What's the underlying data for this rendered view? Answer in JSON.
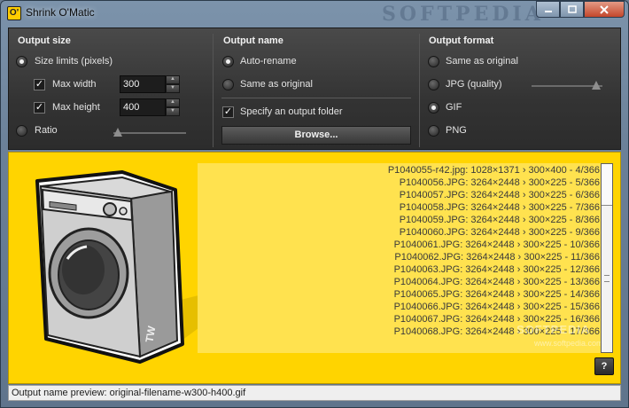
{
  "window": {
    "title": "Shrink O'Matic",
    "app_icon_glyph": "O'",
    "watermark": "SOFTPEDIA",
    "controls": [
      "minimize-icon",
      "maximize-icon",
      "close-icon"
    ]
  },
  "output_size": {
    "title": "Output size",
    "size_limits_label": "Size limits (pixels)",
    "size_limits_selected": true,
    "max_width_label": "Max width",
    "max_width_checked": true,
    "max_width_value": "300",
    "max_height_label": "Max height",
    "max_height_checked": true,
    "max_height_value": "400",
    "ratio_label": "Ratio",
    "ratio_selected": false
  },
  "output_name": {
    "title": "Output name",
    "auto_rename_label": "Auto-rename",
    "auto_rename_selected": true,
    "same_as_original_label": "Same as original",
    "specify_folder_label": "Specify an output folder",
    "specify_folder_checked": true,
    "browse_label": "Browse..."
  },
  "output_format": {
    "title": "Output format",
    "options": [
      {
        "label": "Same as original",
        "selected": false
      },
      {
        "label": "JPG (quality)",
        "selected": false
      },
      {
        "label": "GIF",
        "selected": true
      },
      {
        "label": "PNG",
        "selected": false
      }
    ]
  },
  "log": {
    "lines": [
      "P1040055-r42.jpg: 1028×1371 › 300×400 - 4/366",
      "P1040056.JPG: 3264×2448 › 300×225 - 5/366",
      "P1040057.JPG: 3264×2448 › 300×225 - 6/366",
      "P1040058.JPG: 3264×2448 › 300×225 - 7/366",
      "P1040059.JPG: 3264×2448 › 300×225 - 8/366",
      "P1040060.JPG: 3264×2448 › 300×225 - 9/366",
      "P1040061.JPG: 3264×2448 › 300×225 - 10/366",
      "P1040062.JPG: 3264×2448 › 300×225 - 11/366",
      "P1040063.JPG: 3264×2448 › 300×225 - 12/366",
      "P1040064.JPG: 3264×2448 › 300×225 - 13/366",
      "P1040065.JPG: 3264×2448 › 300×225 - 14/366",
      "P1040066.JPG: 3264×2448 › 300×225 - 15/366",
      "P1040067.JPG: 3264×2448 › 300×225 - 16/366",
      "P1040068.JPG: 3264×2448 › 300×225 - 17/366"
    ],
    "watermark": "SOFTPEDIA",
    "watermark_url": "www.softpedia.com"
  },
  "help_label": "?",
  "status": {
    "text": "Output name preview: original-filename-w300-h400.gif"
  },
  "colors": {
    "accent_yellow": "#ffd400",
    "panel_dark": "#333333"
  }
}
